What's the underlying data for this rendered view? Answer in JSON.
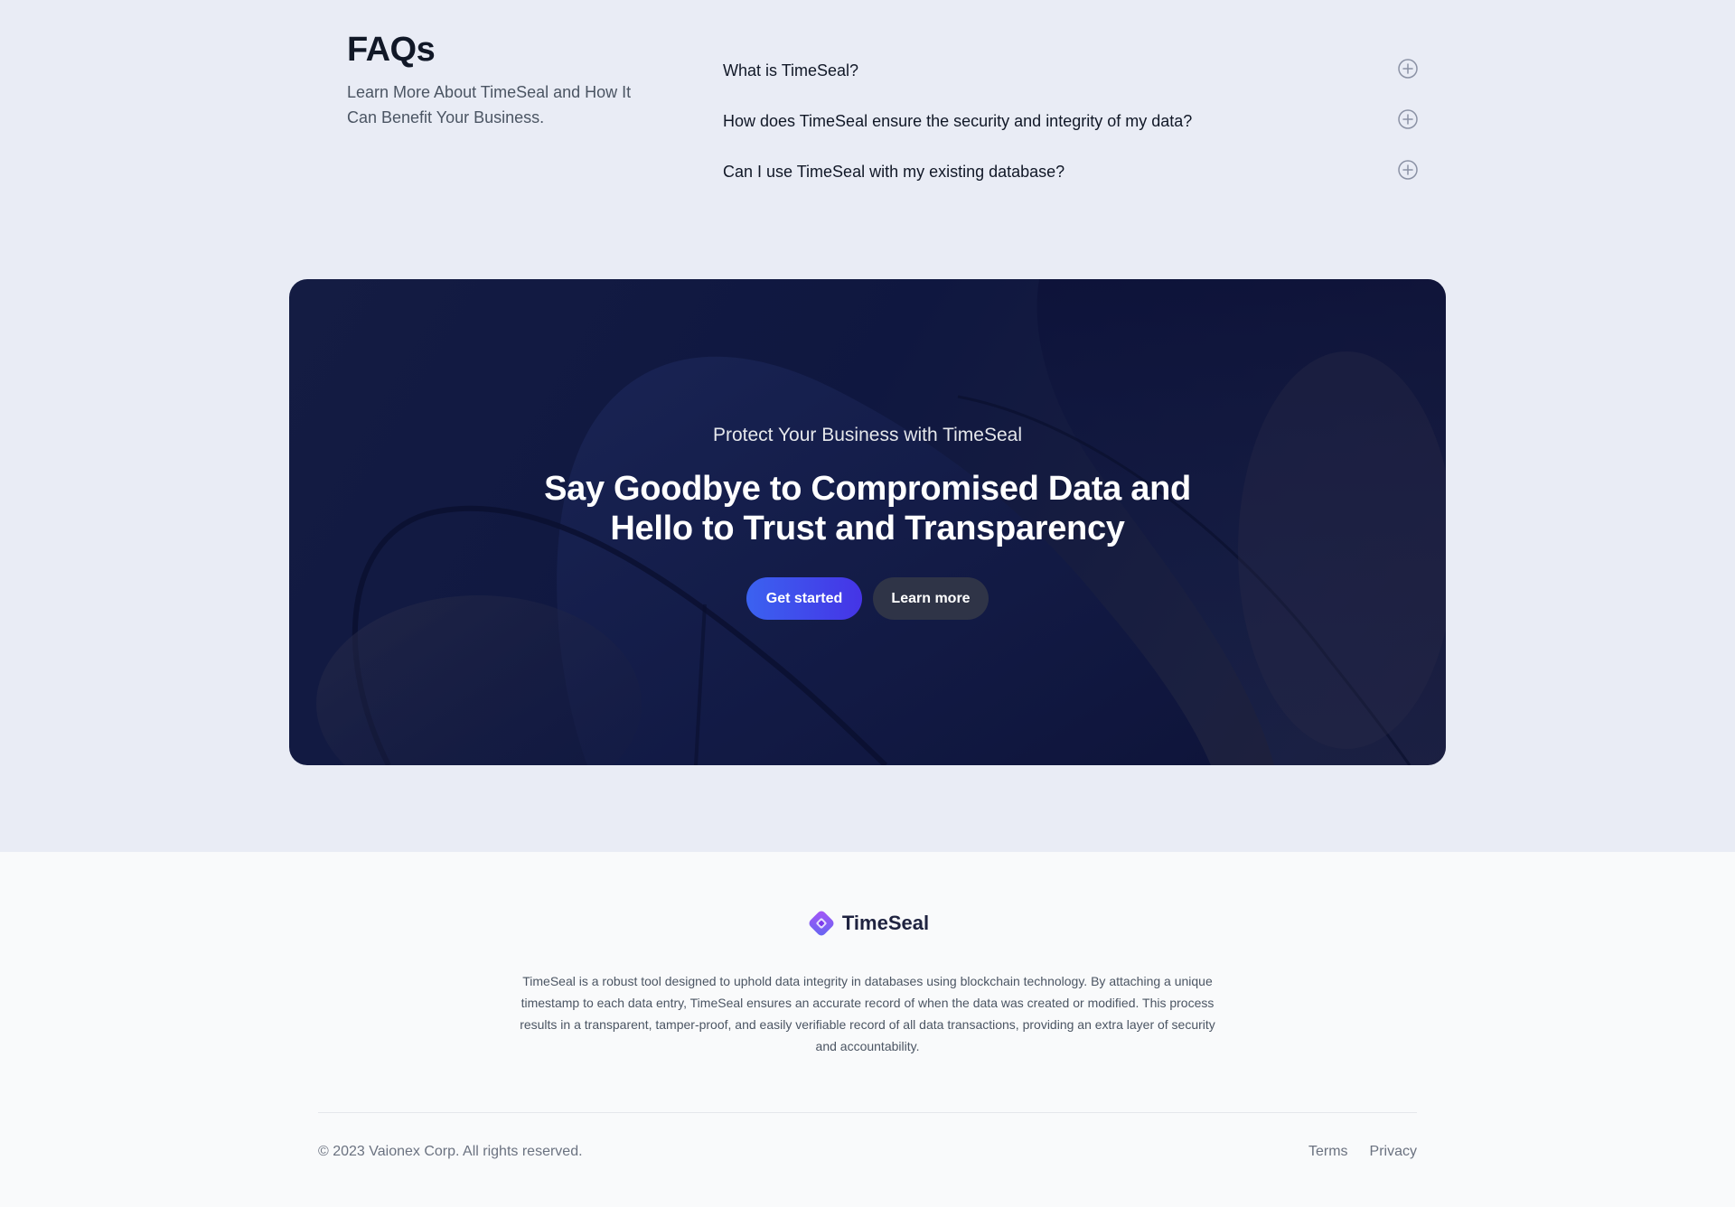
{
  "faq": {
    "title": "FAQs",
    "subtitle": "Learn More About TimeSeal and How It Can Benefit Your Business.",
    "items": [
      {
        "question": "What is TimeSeal?",
        "icon": "plus-circle-icon"
      },
      {
        "question": "How does TimeSeal ensure the security and integrity of my data?",
        "icon": "plus-circle-icon"
      },
      {
        "question": "Can I use TimeSeal with my existing database?",
        "icon": "plus-circle-icon"
      }
    ]
  },
  "cta": {
    "eyebrow": "Protect Your Business with TimeSeal",
    "heading": "Say Goodbye to Compromised Data and Hello to Trust and Transparency",
    "primary_button": "Get started",
    "secondary_button": "Learn more"
  },
  "footer": {
    "brand_name": "TimeSeal",
    "description": "TimeSeal is a robust tool designed to uphold data integrity in databases using blockchain technology. By attaching a unique timestamp to each data entry, TimeSeal ensures an accurate record of when the data was created or modified. This process results in a transparent, tamper-proof, and easily verifiable record of all data transactions, providing an extra layer of security and accountability.",
    "copyright": "© 2023 Vaionex Corp. All rights reserved.",
    "links": [
      "Terms",
      "Privacy"
    ]
  },
  "colors": {
    "page_bg": "#e9ecf5",
    "cta_bg": "#0f1740",
    "primary_button": "#3b62f0",
    "secondary_button": "#2f3447",
    "footer_bg": "#f9fafb",
    "brand_accent": "#8b5cf6"
  }
}
